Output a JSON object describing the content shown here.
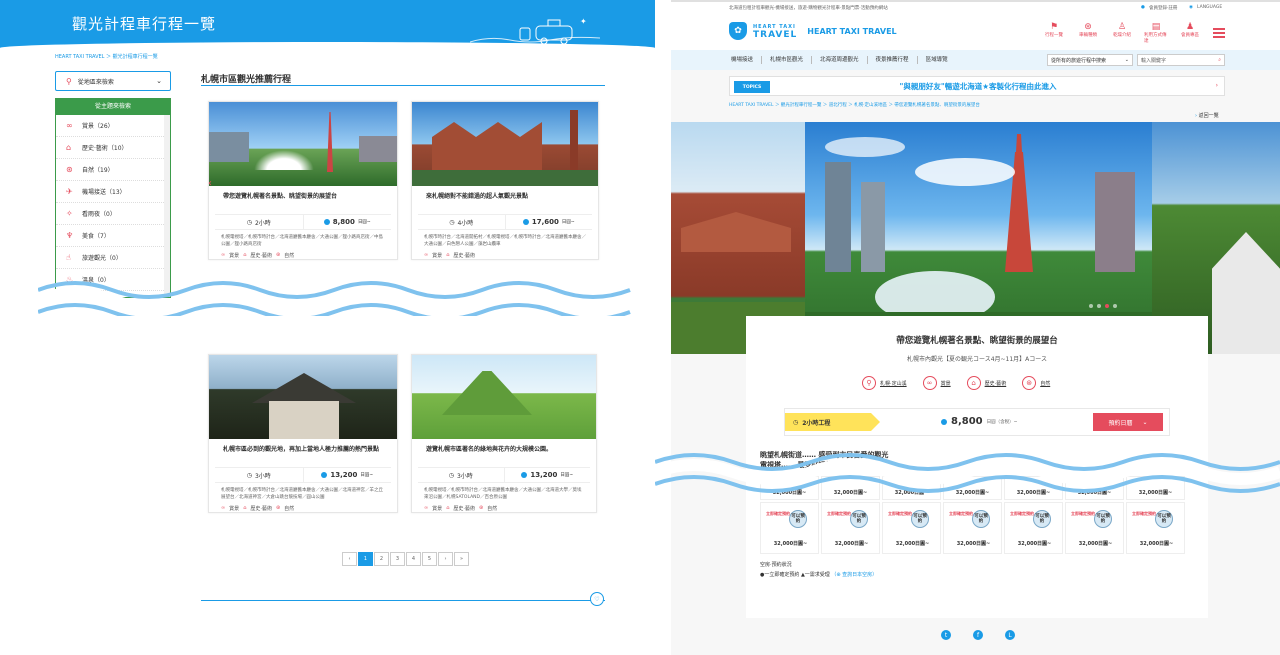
{
  "left": {
    "header_title": "觀光計程車行程一覽",
    "breadcrumb": "HEART TAXI TRAVEL  ＞  觀光計程車行程一覽",
    "dropdown": "從地區來檢索",
    "category_header": "從主題來檢索",
    "categories": [
      {
        "label": "賞景（26）",
        "icon": "binoculars-icon"
      },
      {
        "label": "歷史·藝術（10）",
        "icon": "museum-icon"
      },
      {
        "label": "自然（19）",
        "icon": "car-icon"
      },
      {
        "label": "機場接送（13）",
        "icon": "airplane-icon"
      },
      {
        "label": "看雨夜（0）",
        "icon": "sparkle-icon"
      },
      {
        "label": "美食（7）",
        "icon": "fork-knife-icon"
      },
      {
        "label": "旅遊觀光（0）",
        "icon": "hand-icon"
      },
      {
        "label": "溫泉（0）",
        "icon": "hot-spring-icon"
      }
    ],
    "section_title": "札幌市區觀光推薦行程",
    "cards": [
      {
        "title": "帶您遊覽札幌著名景點、眺望街景的展望台",
        "hours": "2小時",
        "price": "8,800",
        "unit": "日圓~",
        "spots": "札幌電視塔／札幌市時計台／北海道廳舊本廳舍／大通公園／狸小路商店街／中島公園／狸小路商店街",
        "tags": [
          "賞景",
          "歷史·藝術",
          "自然"
        ]
      },
      {
        "title": "來札幌絕對不能錯過的超人氣觀光景點",
        "hours": "4小時",
        "price": "17,600",
        "unit": "日圓~",
        "spots": "札幌市時計台／北海道開拓村／札幌電視塔／札幌市時計台／北海道廳舊本廳舍／大通公園／白色戀人公園／藻岩山纜車",
        "tags": [
          "賞景",
          "歷史·藝術"
        ]
      },
      {
        "title": "札幌市區必到的觀光地，再加上當地人極力推薦的熱門景點",
        "hours": "3小時",
        "price": "13,200",
        "unit": "日圓~",
        "spots": "札幌電視塔／札幌市時計台／北海道廳舊本廳舍／大通公園／北海道神宮／羊之丘展望台／北海道神宮／大倉山跳台競技場／圓山公園",
        "tags": [
          "賞景",
          "歷史·藝術",
          "自然"
        ]
      },
      {
        "title": "遊覽札幌市區著名的綠地與花卉的大規模公園。",
        "hours": "3小時",
        "price": "13,200",
        "unit": "日圓~",
        "spots": "札幌電視塔／札幌市時計台／北海道廳舊本廳舍／大通公園／北海道大學／莫埃來沼公園／札幌SATOLAND／百合原公園",
        "tags": [
          "賞景",
          "歷史·藝術",
          "自然"
        ]
      }
    ],
    "pagination": [
      "‹",
      "1",
      "2",
      "3",
      "4",
      "5",
      "›",
      "»"
    ]
  },
  "right": {
    "top_bar": "北海道包租計程車觀光·機場接送，旅遊·購物觀光計程車·景點門票·活動預約網站",
    "top_links": [
      "會員登錄·註冊",
      "LANGUAGE"
    ],
    "logo_text": "HEART TAXI TRAVEL",
    "logo_small": "HEART TAXI",
    "logo_big": "TRAVEL",
    "nav_icons": [
      "行程一覽",
      "車輛種類",
      "乾燥介紹",
      "利用方式傳達",
      "會員專區"
    ],
    "nav_items": [
      "機場接送",
      "札幌市區觀光",
      "北海道周邊觀光",
      "夜景推薦行程",
      "區域導覽"
    ],
    "select_placeholder": "從所有的旅遊行程中搜索",
    "search_placeholder": "輸入關鍵字",
    "topics_tag": "TOPICS",
    "topics_text": "\"與親朋好友\"暢遊北海道★客製化行程由此進入",
    "breadcrumb": "HEART TAXI TRAVEL  ＞  觀光計程車行程一覽  ＞  道北行程  ＞  札幌·定山溪地區  ＞  帶您遊覽札幌著名景點、眺望街景的展望台",
    "back": "返回一覽",
    "detail_title": "帶您遊覽札幌著名景點、眺望街景的展望台",
    "detail_sub": "札幌市內觀光【夏の観光コース4月~11月】Aコース",
    "tags": [
      "札幌·定山溪",
      "賞景",
      "歷史·藝術",
      "自然"
    ],
    "hours": "2小時工程",
    "price": "8,800",
    "price_unit": "日圓（含稅）~",
    "reserve": "預約日曆",
    "desc_l1": "眺望札幌街道…… 感受到市民喜愛的觀光",
    "desc_l2": "電視塔……  最受好評的……",
    "cal_row1": [
      "32,000日圓~",
      "32,000日圓~",
      "32,000日圓~",
      "32,000日圓~",
      "32,000日圓~",
      "32,000日圓~",
      "32,000日圓~"
    ],
    "cal_red": "立即確定預約",
    "cal_badge": "可以預約",
    "cal_price": "32,000日圓~",
    "legend_title": "空房·預約狀況",
    "legend_text": "●一立即確定預約  ▲一需求受理",
    "legend_link": "（⊕ 查詢日本空房）"
  }
}
